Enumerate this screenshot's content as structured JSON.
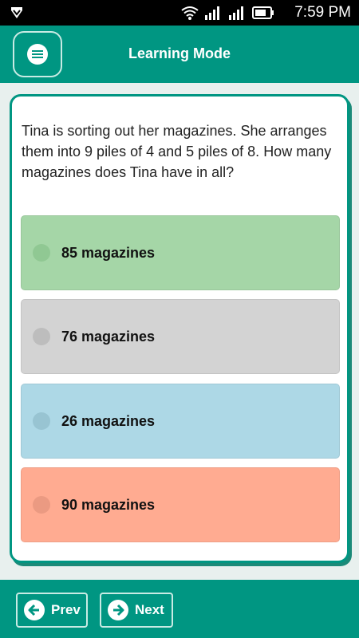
{
  "status_bar": {
    "time": "7:59 PM",
    "icons": [
      "app-shield-icon",
      "wifi-icon",
      "signal-icon",
      "signal-icon",
      "battery-icon"
    ]
  },
  "header": {
    "title": "Learning Mode",
    "menu_icon": "menu-icon"
  },
  "quiz": {
    "question": "Tina is sorting out her magazines. She arranges them into 9 piles of 4 and 5 piles of 8. How many magazines does Tina have in all?",
    "options": [
      {
        "label": "85 magazines",
        "color": "#a5d6a7",
        "radio_color": "#90c893"
      },
      {
        "label": "76 magazines",
        "color": "#d3d3d3",
        "radio_color": "#bdbdbd"
      },
      {
        "label": "26 magazines",
        "color": "#add8e6",
        "radio_color": "#98c4d2"
      },
      {
        "label": "90 magazines",
        "color": "#ffab91",
        "radio_color": "#eb9a82"
      }
    ]
  },
  "footer": {
    "prev_label": "Prev",
    "next_label": "Next"
  },
  "colors": {
    "primary": "#009682",
    "card_border": "#009682"
  }
}
